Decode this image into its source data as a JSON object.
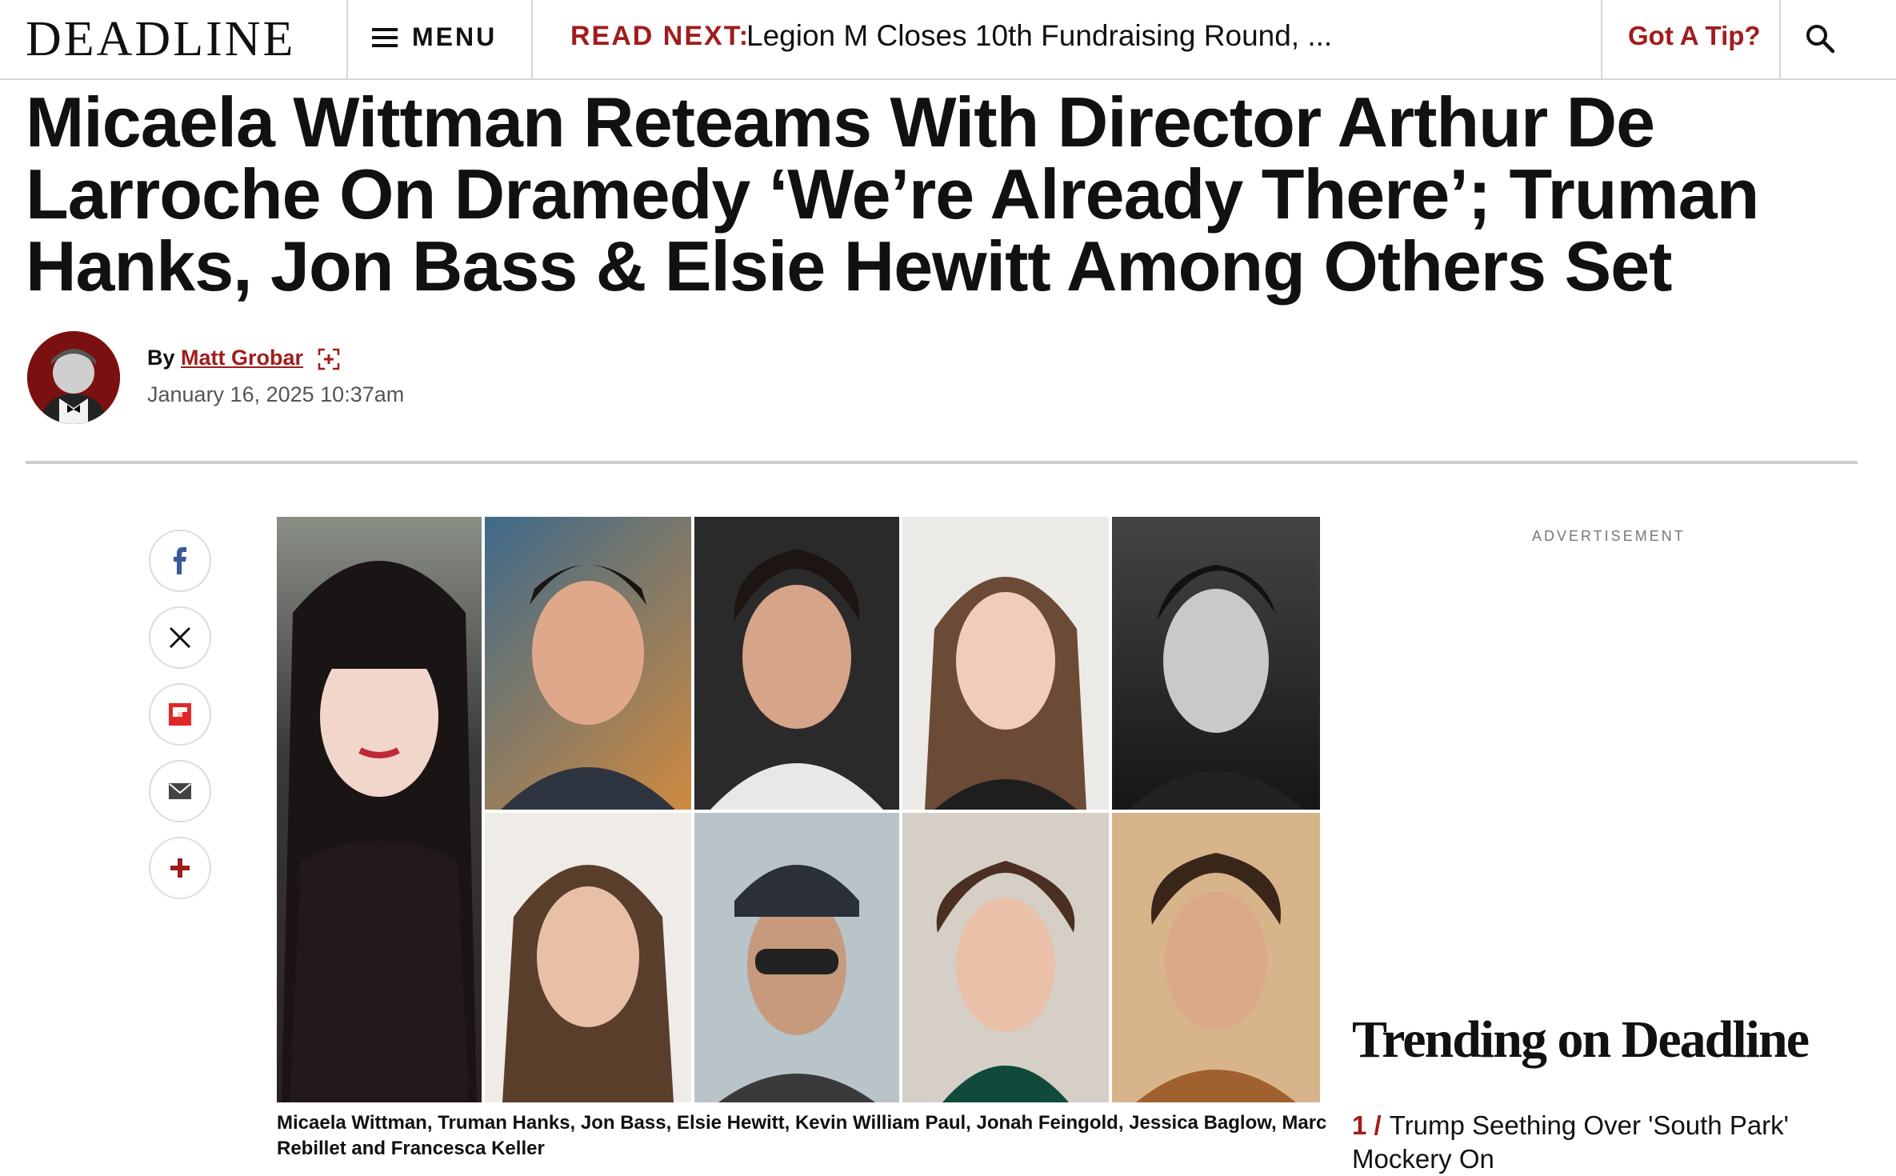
{
  "header": {
    "logo": "DEADLINE",
    "menu_label": "MENU",
    "read_next_label": "READ NEXT:",
    "read_next_title": "Legion M Closes 10th Fundraising Round, ...",
    "tip_label": "Got A Tip?"
  },
  "article": {
    "headline": "Micaela Wittman Reteams With Director Arthur De Larroche On Dramedy ‘We’re Already There’; Truman Hanks, Jon Bass & Elsie Hewitt Among Others Set",
    "by_prefix": "By",
    "author": "Matt Grobar",
    "date": "January 16, 2025 10:37am",
    "caption": "Micaela Wittman, Truman Hanks, Jon Bass, Elsie Hewitt, Kevin William Paul, Jonah Feingold, Jessica Baglow, Marc Rebillet and Francesca Keller"
  },
  "share": [
    "facebook-icon",
    "x-icon",
    "flipboard-icon",
    "email-icon",
    "more-icon"
  ],
  "sidebar": {
    "ad_label": "ADVERTISEMENT",
    "trending_title": "Trending on Deadline",
    "trending": [
      {
        "num": "1 /",
        "title": "Trump Seething Over 'South Park' Mockery On"
      }
    ]
  },
  "colors": {
    "accent": "#a11c1c",
    "text": "#111111",
    "rule": "#cccccc"
  }
}
